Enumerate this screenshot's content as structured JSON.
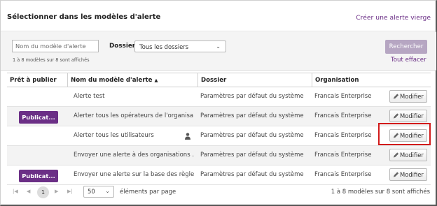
{
  "header": {
    "title": "Sélectionner dans les modèles d'alerte",
    "create_link": "Créer une alerte vierge"
  },
  "filters": {
    "name_placeholder": "Nom du modèle d'alerte",
    "count_text": "1 à 8 modèles sur 8 sont affichés",
    "folder_label": "Dossier",
    "folder_value": "Tous les dossiers",
    "search_label": "Rechercher",
    "clear_label": "Tout effacer"
  },
  "table": {
    "columns": [
      "Prêt à publier",
      "Nom du modèle d'alerte",
      "Dossier",
      "Organisation"
    ],
    "sorted_column": "Nom du modèle d'alerte",
    "rows": [
      {
        "publish": "",
        "name": "Alerte test",
        "folder": "Paramètres par défaut du système",
        "org": "Francais Enterprise",
        "action": "Modifier"
      },
      {
        "publish": "Publicat...",
        "name": "Alerter tous les opérateurs de l'organisa...",
        "folder": "Paramètres par défaut du système",
        "org": "Francais Enterprise",
        "action": "Modifier"
      },
      {
        "publish": "",
        "name": "Alerter tous les utilisateurs",
        "folder": "Paramètres par défaut du système",
        "org": "Francais Enterprise",
        "action": "Modifier"
      },
      {
        "publish": "",
        "name": "Envoyer une alerte à des organisations ...",
        "folder": "Paramètres par défaut du système",
        "org": "Francais Enterprise",
        "action": "Modifier"
      },
      {
        "publish": "Publicat...",
        "name": "Envoyer une alerte sur la base des règle...",
        "folder": "Paramètres par défaut du système",
        "org": "Francais Enterprise",
        "action": "Modifier"
      }
    ]
  },
  "pagination": {
    "current_page": "1",
    "per_page_value": "50",
    "per_page_label": "éléments par page",
    "count_text": "1 à 8 modèles sur 8 sont affichés"
  },
  "colors": {
    "brand": "#6b2f86",
    "highlight": "#d21a1a"
  },
  "icons": [
    "pencil-icon",
    "user-icon",
    "chevron-down-icon",
    "first-page-icon",
    "prev-page-icon",
    "next-page-icon",
    "last-page-icon",
    "sort-ascending-icon"
  ]
}
